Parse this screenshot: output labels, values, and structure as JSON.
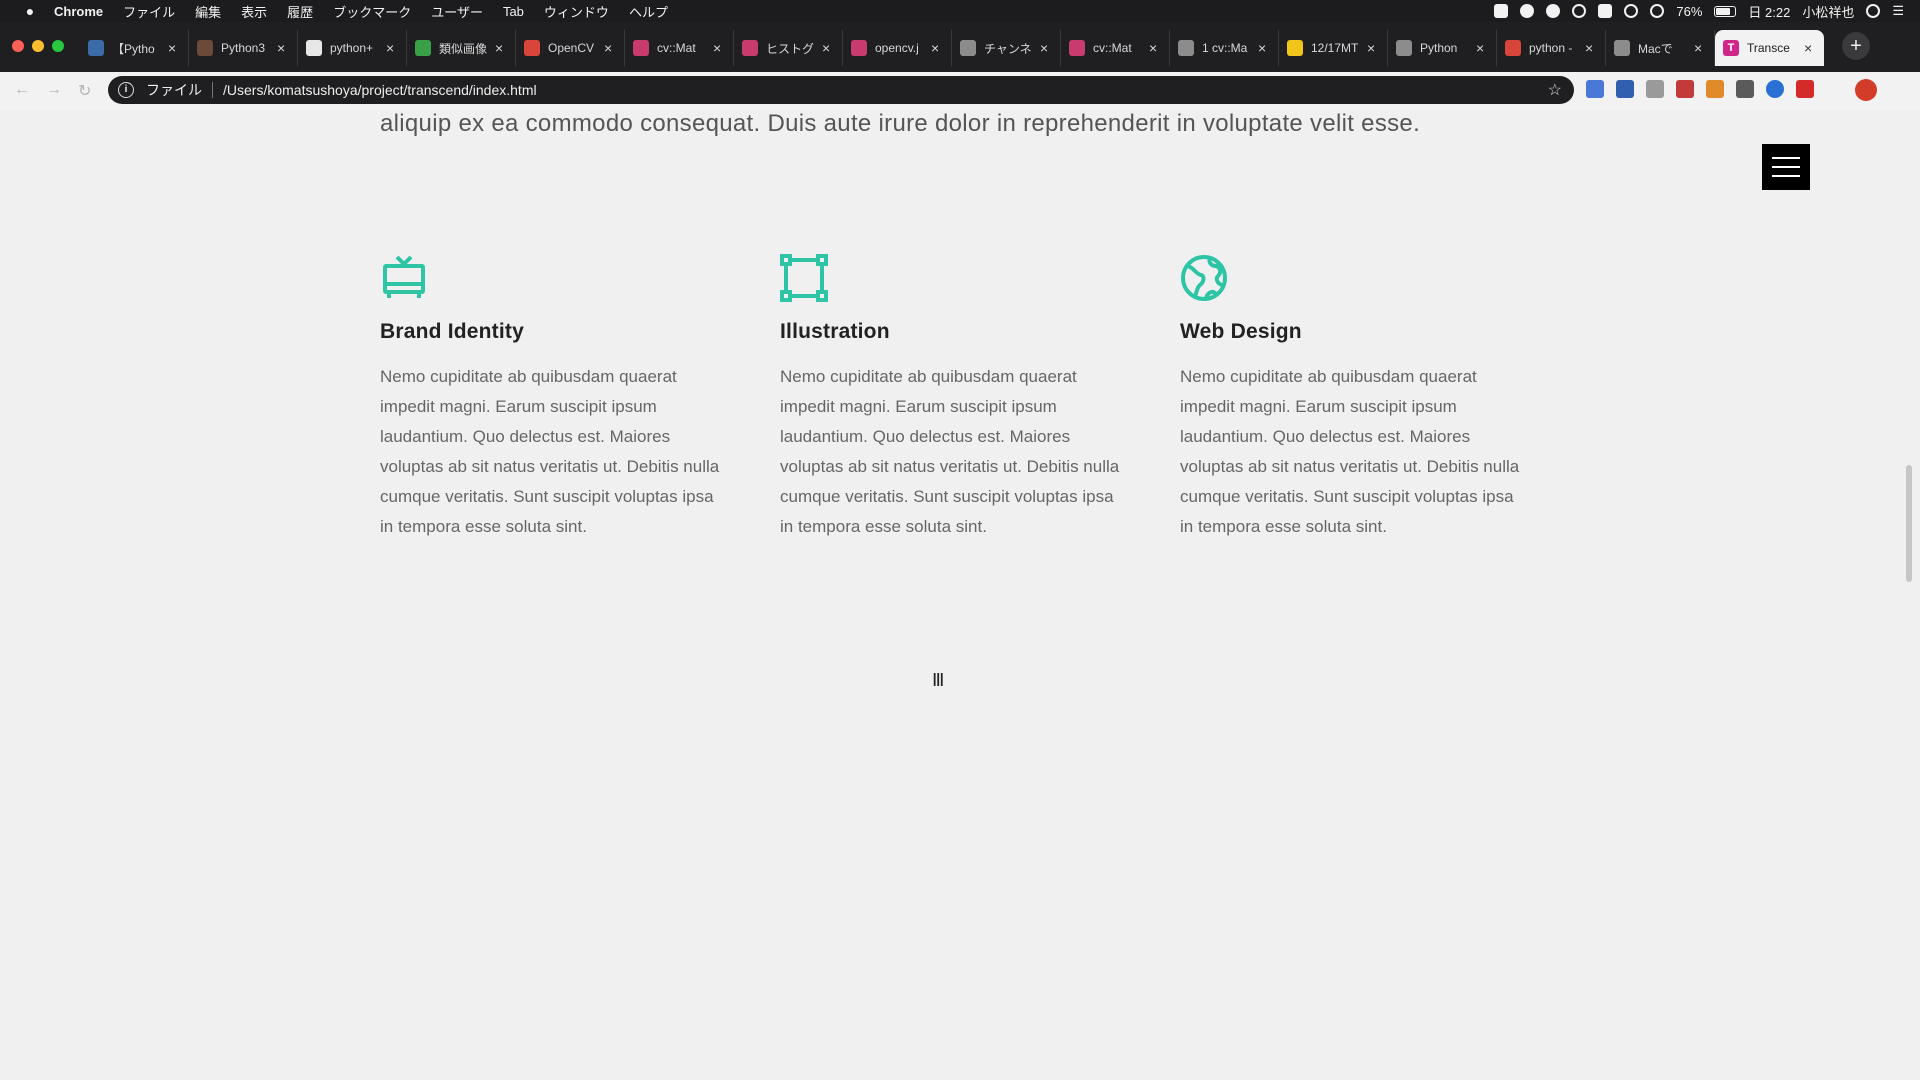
{
  "menubar": {
    "app": "Chrome",
    "items": [
      "ファイル",
      "編集",
      "表示",
      "履歴",
      "ブックマーク",
      "ユーザー",
      "Tab",
      "ウィンドウ",
      "ヘルプ"
    ],
    "battery": "76%",
    "clock": "日 2:22",
    "user": "小松祥也"
  },
  "tabs": [
    {
      "title": "【Pytho",
      "color": "#3b6aa8"
    },
    {
      "title": "Python3",
      "color": "#6b4a3a"
    },
    {
      "title": "python+",
      "color": "#e6e6e6"
    },
    {
      "title": "類似画像",
      "color": "#3aa047"
    },
    {
      "title": "OpenCV",
      "color": "#d9443b"
    },
    {
      "title": "cv::Mat",
      "color": "#c93a6e"
    },
    {
      "title": "ヒストグ",
      "color": "#c93a6e"
    },
    {
      "title": "opencv.j",
      "color": "#c93a6e"
    },
    {
      "title": "チャンネ",
      "color": "#8c8c8c"
    },
    {
      "title": "cv::Mat",
      "color": "#c93a6e"
    },
    {
      "title": "1 cv::Ma",
      "color": "#8c8c8c"
    },
    {
      "title": "12/17MT",
      "color": "#f0c419"
    },
    {
      "title": "Python",
      "color": "#8c8c8c"
    },
    {
      "title": "python -",
      "color": "#d9443b"
    },
    {
      "title": "Macで",
      "color": "#8c8c8c"
    },
    {
      "title": "Transce",
      "color": "#d0268a",
      "favicon_letter": "T",
      "active": true
    }
  ],
  "toolbar": {
    "protocol_label": "ファイル",
    "url": "/Users/komatsushoya/project/transcend/index.html"
  },
  "page": {
    "intro_text": "aliquip ex ea commodo consequat. Duis aute irure dolor in reprehenderit in voluptate velit esse.",
    "accent_color": "#2ec4a6",
    "features": [
      {
        "icon": "tv-icon",
        "title": "Brand Identity",
        "text": "Nemo cupiditate ab quibusdam quaerat impedit magni. Earum suscipit ipsum laudantium. Quo delectus est. Maiores voluptas ab sit natus veritatis ut. Debitis nulla cumque veritatis. Sunt suscipit voluptas ipsa in tempora esse soluta sint."
      },
      {
        "icon": "vector-square-icon",
        "title": "Illustration",
        "text": "Nemo cupiditate ab quibusdam quaerat impedit magni. Earum suscipit ipsum laudantium. Quo delectus est. Maiores voluptas ab sit natus veritatis ut. Debitis nulla cumque veritatis. Sunt suscipit voluptas ipsa in tempora esse soluta sint."
      },
      {
        "icon": "globe-icon",
        "title": "Web Design",
        "text": "Nemo cupiditate ab quibusdam quaerat impedit magni. Earum suscipit ipsum laudantium. Quo delectus est. Maiores voluptas ab sit natus veritatis ut. Debitis nulla cumque veritatis. Sunt suscipit voluptas ipsa in tempora esse soluta sint."
      }
    ]
  }
}
